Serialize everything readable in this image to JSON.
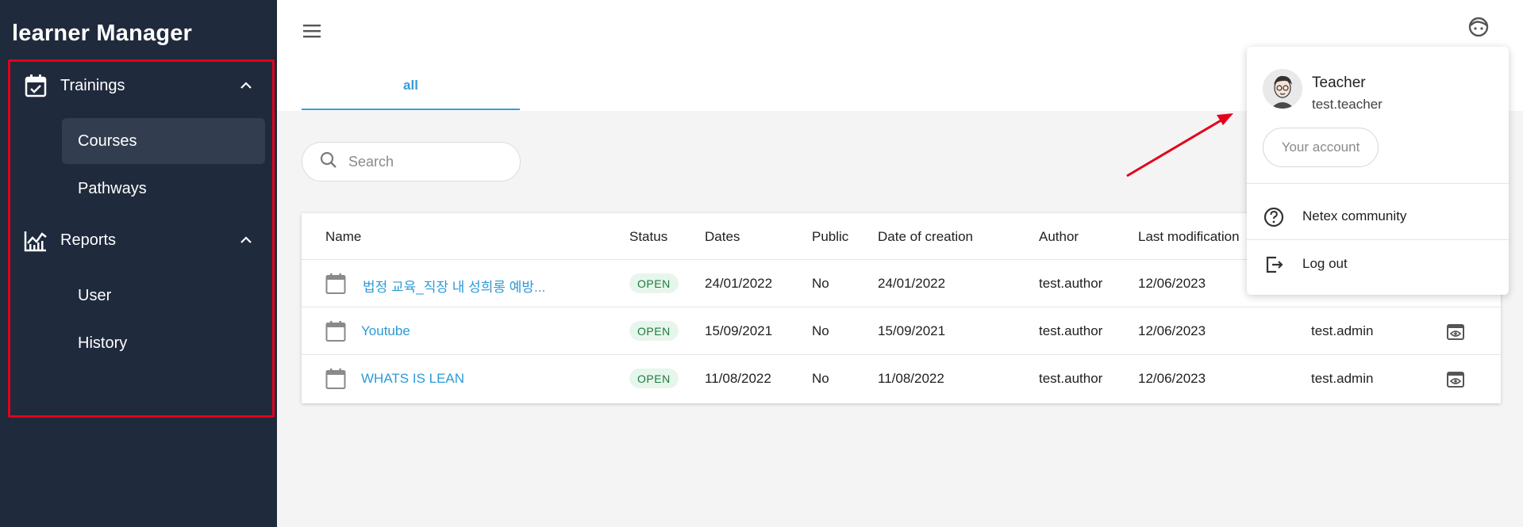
{
  "app": {
    "title": "learner Manager"
  },
  "sidebar": {
    "sections": [
      {
        "label": "Trainings",
        "icon": "calendar-check-icon",
        "items": [
          {
            "label": "Courses",
            "active": true
          },
          {
            "label": "Pathways",
            "active": false
          }
        ]
      },
      {
        "label": "Reports",
        "icon": "chart-icon",
        "items": [
          {
            "label": "User",
            "active": false
          },
          {
            "label": "History",
            "active": false
          }
        ]
      }
    ]
  },
  "tabs": [
    {
      "label": "all",
      "active": true
    }
  ],
  "search": {
    "placeholder": "Search",
    "value": ""
  },
  "table": {
    "headers": [
      "Name",
      "Status",
      "Dates",
      "Public",
      "Date of creation",
      "Author",
      "Last modification"
    ],
    "rows": [
      {
        "name": "법정 교육_직장 내 성희롱 예방...",
        "status": "OPEN",
        "dates": "24/01/2022",
        "public": "No",
        "created": "24/01/2022",
        "author": "test.author",
        "modified": "12/06/2023",
        "modifier": ""
      },
      {
        "name": "Youtube",
        "status": "OPEN",
        "dates": "15/09/2021",
        "public": "No",
        "created": "15/09/2021",
        "author": "test.author",
        "modified": "12/06/2023",
        "modifier": "test.admin"
      },
      {
        "name": "WHATS IS LEAN",
        "status": "OPEN",
        "dates": "11/08/2022",
        "public": "No",
        "created": "11/08/2022",
        "author": "test.author",
        "modified": "12/06/2023",
        "modifier": "test.admin"
      }
    ]
  },
  "user_menu": {
    "name": "Teacher",
    "username": "test.teacher",
    "account_label": "Your account",
    "items": [
      {
        "label": "Netex community",
        "icon": "help-circle-icon"
      },
      {
        "label": "Log out",
        "icon": "logout-icon"
      }
    ]
  },
  "colors": {
    "sidebar_bg": "#1f2a3c",
    "accent": "#3a9ad9",
    "annotation_red": "#e3001b",
    "status_green": "#1b7a3d"
  }
}
